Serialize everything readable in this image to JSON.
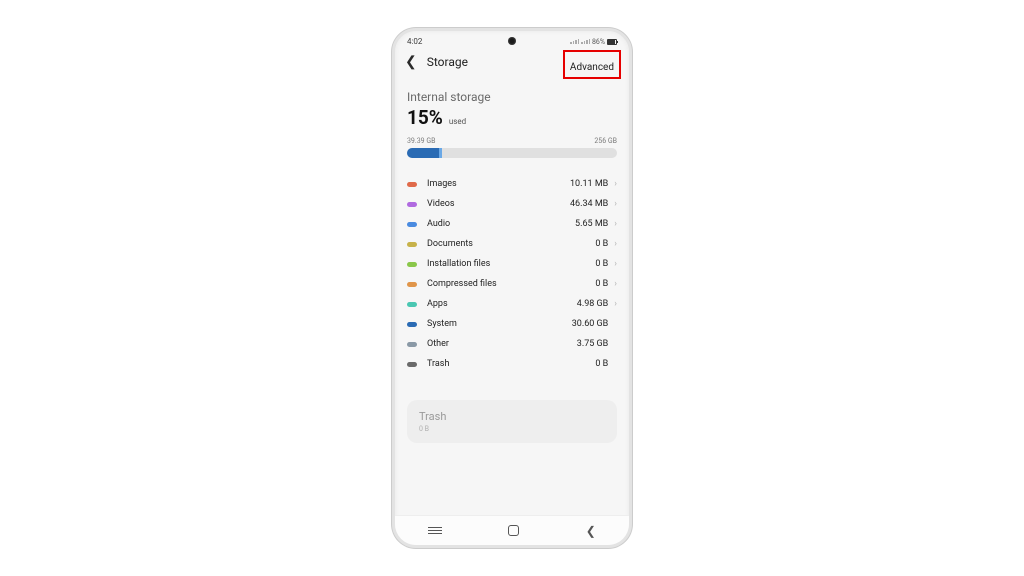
{
  "status": {
    "time": "4:02",
    "battery_pct": "86%"
  },
  "header": {
    "title": "Storage",
    "advanced_label": "Advanced"
  },
  "summary": {
    "section_title": "Internal storage",
    "pct": "15%",
    "used_label": "used",
    "used_size": "39.39 GB",
    "total_size": "256 GB"
  },
  "categories": [
    {
      "label": "Images",
      "size": "10.11 MB",
      "color": "#e06a4a",
      "clickable": true
    },
    {
      "label": "Videos",
      "size": "46.34 MB",
      "color": "#b06ae0",
      "clickable": true
    },
    {
      "label": "Audio",
      "size": "5.65 MB",
      "color": "#4a8be0",
      "clickable": true
    },
    {
      "label": "Documents",
      "size": "0 B",
      "color": "#c7b24a",
      "clickable": true
    },
    {
      "label": "Installation files",
      "size": "0 B",
      "color": "#8ac74a",
      "clickable": true
    },
    {
      "label": "Compressed files",
      "size": "0 B",
      "color": "#e0954a",
      "clickable": true
    },
    {
      "label": "Apps",
      "size": "4.98 GB",
      "color": "#4ac7b2",
      "clickable": true
    },
    {
      "label": "System",
      "size": "30.60 GB",
      "color": "#2a6bb4",
      "clickable": false
    },
    {
      "label": "Other",
      "size": "3.75 GB",
      "color": "#8a99a6",
      "clickable": false
    },
    {
      "label": "Trash",
      "size": "0 B",
      "color": "#6a6a6a",
      "clickable": false
    }
  ],
  "trash_card": {
    "title": "Trash",
    "size": "0 B"
  }
}
